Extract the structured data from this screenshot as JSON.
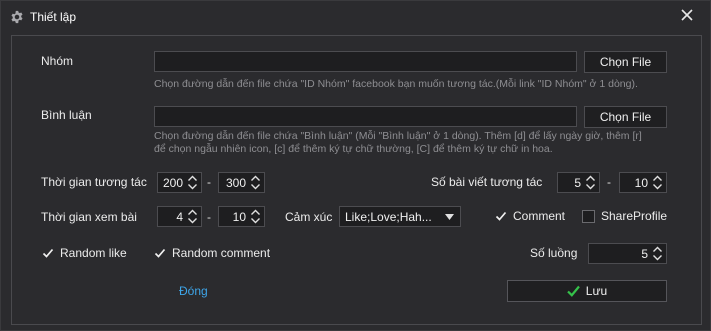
{
  "window": {
    "title": "Thiết lập",
    "icon": "gear-icon",
    "close_icon": "close-icon"
  },
  "group": {
    "label": "Nhóm",
    "value": "",
    "button": "Chọn File",
    "hint": "Chọn đường dẫn đến file chứa \"ID Nhóm\" facebook bạn muốn tương tác.(Mỗi link \"ID Nhóm\" ở 1 dòng)."
  },
  "comment_file": {
    "label": "Bình luận",
    "value": "",
    "button": "Chọn File",
    "hint_line1": "Chọn đường dẫn đến file chứa \"Bình luận\" (Mỗi \"Bình luận\" ở 1 dòng). Thêm [d] để lấy ngày giờ, thêm [r]",
    "hint_line2": "để chọn ngẫu nhiên icon, [c] để thêm ký tự chữ thường, [C] để thêm ký tự chữ in hoa."
  },
  "interaction_time": {
    "label": "Thời gian tương tác",
    "from": "200",
    "to": "300",
    "separator": "-"
  },
  "post_count": {
    "label": "Số bài viết tương tác",
    "from": "5",
    "to": "10",
    "separator": "-"
  },
  "view_time": {
    "label": "Thời gian xem bài",
    "from": "4",
    "to": "10",
    "separator": "-"
  },
  "emotion": {
    "label": "Cảm xúc",
    "value": "Like;Love;Hah..."
  },
  "checkboxes": {
    "comment": {
      "label": "Comment",
      "checked": true
    },
    "share_profile": {
      "label": "ShareProfile",
      "checked": false
    },
    "random_like": {
      "label": "Random like",
      "checked": true
    },
    "random_comment": {
      "label": "Random comment",
      "checked": true
    }
  },
  "threads": {
    "label": "Số luồng",
    "value": "5"
  },
  "footer": {
    "close_link": "Đóng",
    "save_label": "Lưu",
    "save_icon": "check-icon"
  },
  "colors": {
    "background": "#2b2b2e",
    "input_bg": "#1e1e20",
    "link": "#3ea6ea",
    "save_check": "#35c24a"
  }
}
